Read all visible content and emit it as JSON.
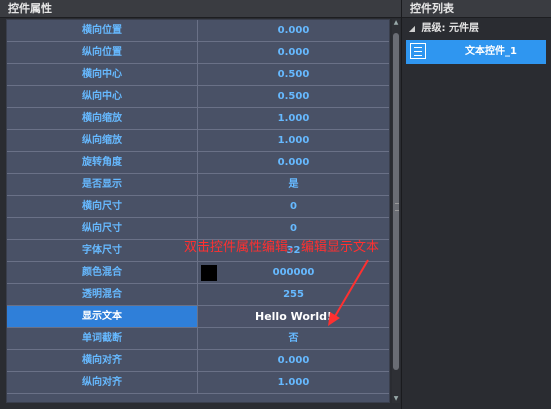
{
  "panels": {
    "left_title": "控件属性",
    "right_title": "控件列表"
  },
  "properties": [
    {
      "label": "横向位置",
      "value": "0.000"
    },
    {
      "label": "纵向位置",
      "value": "0.000"
    },
    {
      "label": "横向中心",
      "value": "0.500"
    },
    {
      "label": "纵向中心",
      "value": "0.500"
    },
    {
      "label": "横向缩放",
      "value": "1.000"
    },
    {
      "label": "纵向缩放",
      "value": "1.000"
    },
    {
      "label": "旋转角度",
      "value": "0.000"
    },
    {
      "label": "是否显示",
      "value": "是"
    },
    {
      "label": "横向尺寸",
      "value": "0"
    },
    {
      "label": "纵向尺寸",
      "value": "0"
    },
    {
      "label": "字体尺寸",
      "value": "32"
    },
    {
      "label": "颜色混合",
      "value": "000000",
      "swatch": "#000000"
    },
    {
      "label": "透明混合",
      "value": "255"
    },
    {
      "label": "显示文本",
      "value": "Hello World!",
      "selected": true
    },
    {
      "label": "单词截断",
      "value": "否"
    },
    {
      "label": "横向对齐",
      "value": "0.000"
    },
    {
      "label": "纵向对齐",
      "value": "1.000"
    }
  ],
  "control_list": {
    "layer_label": "层级: 元件层",
    "items": [
      {
        "label": "文本控件_1",
        "selected": true,
        "icon": "text-control-icon"
      }
    ]
  },
  "annotation": {
    "text": "双击控件属性编辑，编辑显示文本",
    "color": "#ff3030"
  },
  "colors": {
    "accent": "#2f96f0",
    "value_text": "#66b9ff",
    "grid_bg": "#495166"
  }
}
